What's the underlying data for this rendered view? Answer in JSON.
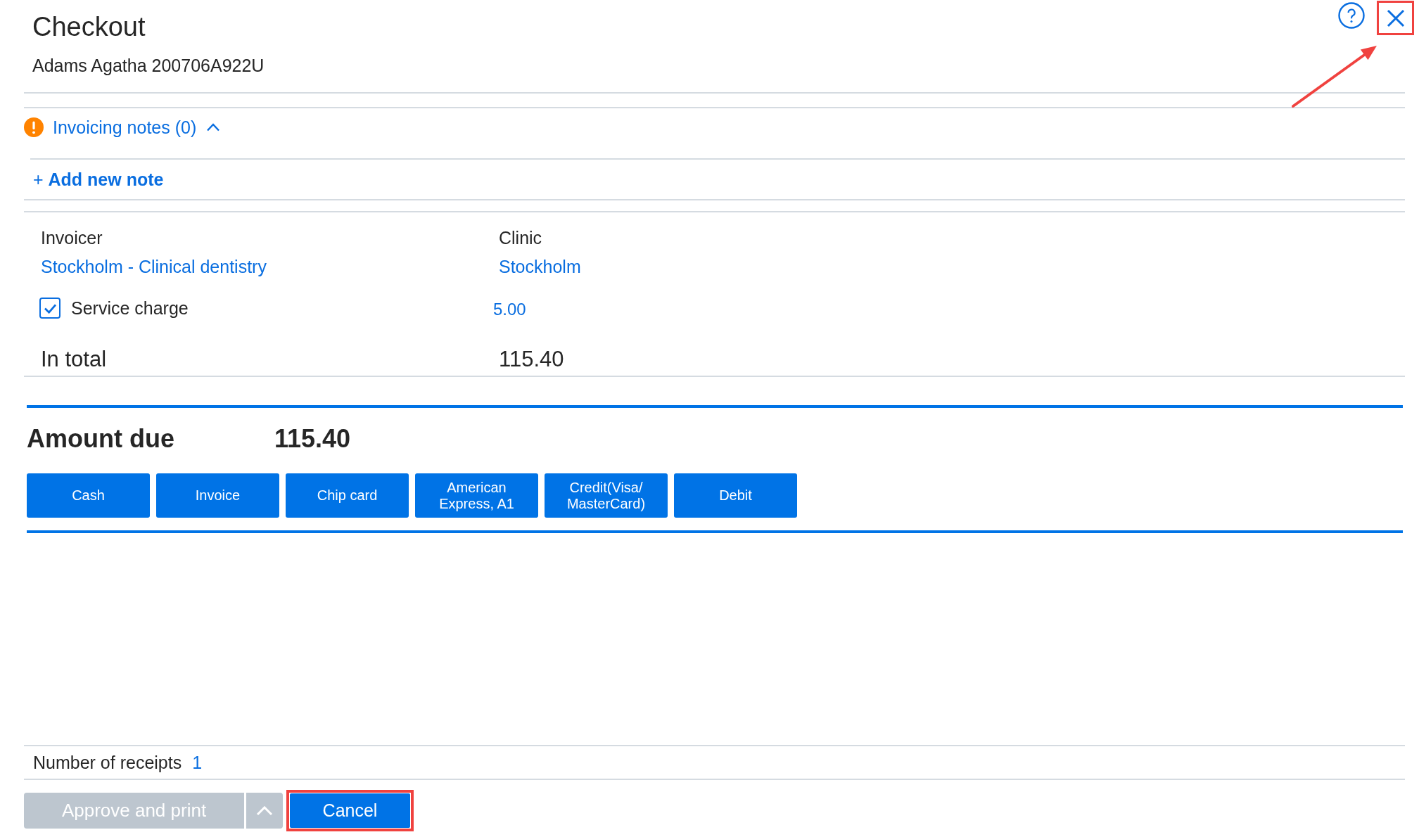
{
  "dialog": {
    "title": "Checkout",
    "patient": "Adams Agatha 200706A922U",
    "close_button": {
      "highlighted": true
    }
  },
  "invoicing_notes": {
    "label": "Invoicing notes (0)",
    "expanded": true,
    "add_note": "+ **Add new note**"
  },
  "details": {
    "invoicer": {
      "label": "Invoicer",
      "value": "Stockholm - Clinical dentistry"
    },
    "clinic": {
      "label": "Clinic",
      "value": "Stockholm"
    },
    "service_charge": {
      "label": "Service charge",
      "checked": true,
      "amount": "5.00"
    },
    "total": {
      "label": "In total",
      "value": "115.40"
    }
  },
  "payment": {
    "label": "Amount due",
    "amount": "115.40",
    "methods": [
      "Cash",
      "Invoice",
      "Chip card",
      "American Express, A1",
      "Credit(Visa/MasterCard)",
      "Debit"
    ]
  },
  "receipts": {
    "label": "Number of receipts",
    "count": "1"
  },
  "actions": [
    {
      "kind": "split",
      "label": "Approve and print",
      "disabled": true,
      "highlighted": false
    },
    {
      "kind": "button",
      "label": "Cancel",
      "disabled": false,
      "highlighted": true
    }
  ]
}
